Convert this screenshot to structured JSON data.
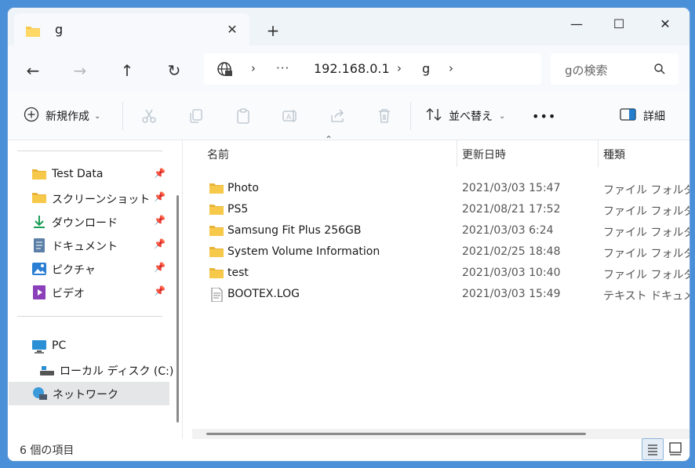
{
  "titlebar": {
    "tab_title": "g",
    "tab_close": "✕",
    "new_tab": "+",
    "minimize": "—",
    "maximize": "☐",
    "close": "✕"
  },
  "nav": {
    "back": "←",
    "forward": "→",
    "up": "↑",
    "refresh": "↻",
    "more": "···",
    "breadcrumb": [
      "192.168.0.1",
      "g"
    ],
    "search_placeholder": "gの検索"
  },
  "commands": {
    "new": "新規作成",
    "sort": "並べ替え",
    "more": "•••",
    "details": "詳細"
  },
  "sidebar": {
    "quick_access": [
      {
        "label": "Test Data",
        "icon": "folder-icon",
        "pinned": true
      },
      {
        "label": "スクリーンショット",
        "icon": "folder-icon",
        "pinned": true
      },
      {
        "label": "ダウンロード",
        "icon": "download-icon",
        "pinned": true
      },
      {
        "label": "ドキュメント",
        "icon": "document-icon",
        "pinned": true
      },
      {
        "label": "ピクチャ",
        "icon": "pictures-icon",
        "pinned": true
      },
      {
        "label": "ビデオ",
        "icon": "video-icon",
        "pinned": true
      }
    ],
    "pc": "PC",
    "local_disk": "ローカル ディスク (C:)",
    "network": "ネットワーク"
  },
  "columns": {
    "name": "名前",
    "modified": "更新日時",
    "type": "種類"
  },
  "files": [
    {
      "name": "Photo",
      "modified": "2021/03/03 15:47",
      "type": "ファイル フォルダー",
      "icon": "folder-icon"
    },
    {
      "name": "PS5",
      "modified": "2021/08/21 17:52",
      "type": "ファイル フォルダー",
      "icon": "folder-icon"
    },
    {
      "name": "Samsung Fit Plus 256GB",
      "modified": "2021/03/03 6:24",
      "type": "ファイル フォルダー",
      "icon": "folder-icon"
    },
    {
      "name": "System Volume Information",
      "modified": "2021/02/25 18:48",
      "type": "ファイル フォルダー",
      "icon": "folder-icon"
    },
    {
      "name": "test",
      "modified": "2021/03/03 10:40",
      "type": "ファイル フォルダー",
      "icon": "folder-icon"
    },
    {
      "name": "BOOTEX.LOG",
      "modified": "2021/03/03 15:49",
      "type": "テキスト ドキュメント",
      "icon": "text-file-icon"
    }
  ],
  "status": {
    "item_count": "6 個の項目"
  },
  "colors": {
    "folder": "#f7c94a",
    "accent": "#0067c0",
    "selected_bg": "#e5e6e8"
  }
}
